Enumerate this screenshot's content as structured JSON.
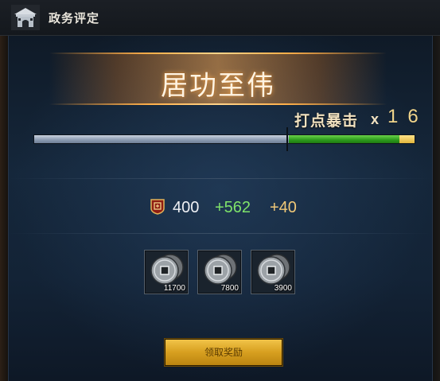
{
  "window": {
    "title": "政务评定",
    "title_icon": "city-gate-icon",
    "close_icon": "close-icon"
  },
  "rating": {
    "label": "居功至伟"
  },
  "crit": {
    "label": "打点暴击",
    "multiplier_symbol": "x",
    "count": "16"
  },
  "progress": {
    "base_fraction": 0.67,
    "bonus_fraction": 0.29,
    "extra_fraction": 0.04,
    "colors": {
      "base": "#9aa8bb",
      "bonus": "#2c9a1c",
      "extra": "#e2b63c"
    }
  },
  "score": {
    "icon": "shield-icon",
    "base": "400",
    "bonus": "+562",
    "extra": "+40"
  },
  "rewards": [
    {
      "icon": "copper-coin-icon",
      "qty": "11700"
    },
    {
      "icon": "copper-coin-icon",
      "qty": "7800"
    },
    {
      "icon": "copper-coin-icon",
      "qty": "3900"
    }
  ],
  "claim_button": {
    "label": "领取奖励"
  }
}
